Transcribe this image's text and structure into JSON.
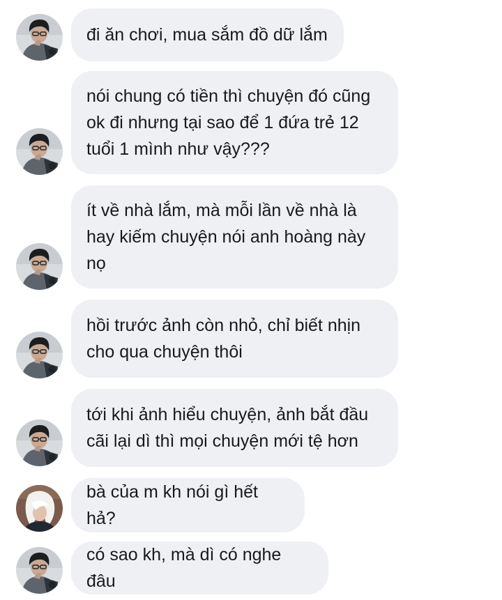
{
  "conversation": {
    "messages": [
      {
        "sender": "friend",
        "avatar": "avatar-boy-glasses",
        "text": "đi ăn chơi, mua sắm đồ dữ lắm"
      },
      {
        "sender": "friend",
        "avatar": "avatar-boy-glasses",
        "text": "nói chung có tiền thì chuyện đó cũng\nok đi nhưng tại sao để 1 đứa trẻ 12\ntuổi 1 mình như vậy???"
      },
      {
        "sender": "friend",
        "avatar": "avatar-boy-glasses",
        "text": "ít về nhà lắm, mà mỗi lần về nhà là\nhay kiếm chuyện nói anh hoàng này\nnọ"
      },
      {
        "sender": "friend",
        "avatar": "avatar-boy-glasses",
        "text": "hồi trước ảnh còn nhỏ, chỉ biết nhịn\ncho qua chuyện thôi"
      },
      {
        "sender": "friend",
        "avatar": "avatar-boy-glasses",
        "text": "tới khi ảnh hiểu chuyện, ảnh bắt đầu\ncãi lại dì thì mọi chuyện mới tệ hơn"
      },
      {
        "sender": "other",
        "avatar": "avatar-white-hair",
        "text": "bà của m kh nói gì hết hả?"
      },
      {
        "sender": "friend",
        "avatar": "avatar-boy-glasses",
        "text": "có sao kh, mà dì có nghe đâu"
      }
    ]
  },
  "colors": {
    "bubble_background": "#eef0f4",
    "text": "#17191c",
    "page_background": "#ffffff"
  }
}
